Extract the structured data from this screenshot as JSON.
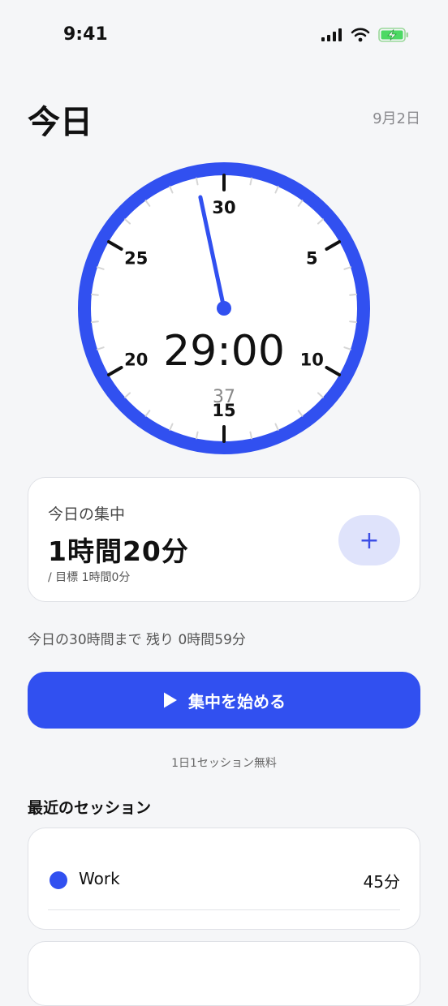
{
  "status_bar": {
    "time": "9:41"
  },
  "header": {
    "title": "今日",
    "date": "9月2日"
  },
  "clock": {
    "dial_numbers": [
      {
        "label": "30",
        "minute": 0
      },
      {
        "label": "5",
        "minute": 5
      },
      {
        "label": "10",
        "minute": 10
      },
      {
        "label": "15",
        "minute": 15
      },
      {
        "label": "20",
        "minute": 20
      },
      {
        "label": "25",
        "minute": 25
      }
    ],
    "time_display": "29:00",
    "seconds_display": "37",
    "hand_minute": 29,
    "accent_color": "#3150f0"
  },
  "focus_card": {
    "label": "今日の集中",
    "value": "1時間20分",
    "goal": "/ 目標 1時間0分",
    "add_label": "+"
  },
  "remaining_text": "今日の30時間まで 残り 0時間59分",
  "start_button": {
    "label": "集中を始める"
  },
  "free_note": "1日1セッション無料",
  "recent": {
    "heading": "最近のセッション",
    "sessions": [
      {
        "name": "Work",
        "duration": "45分",
        "color": "#3150f0"
      }
    ]
  }
}
